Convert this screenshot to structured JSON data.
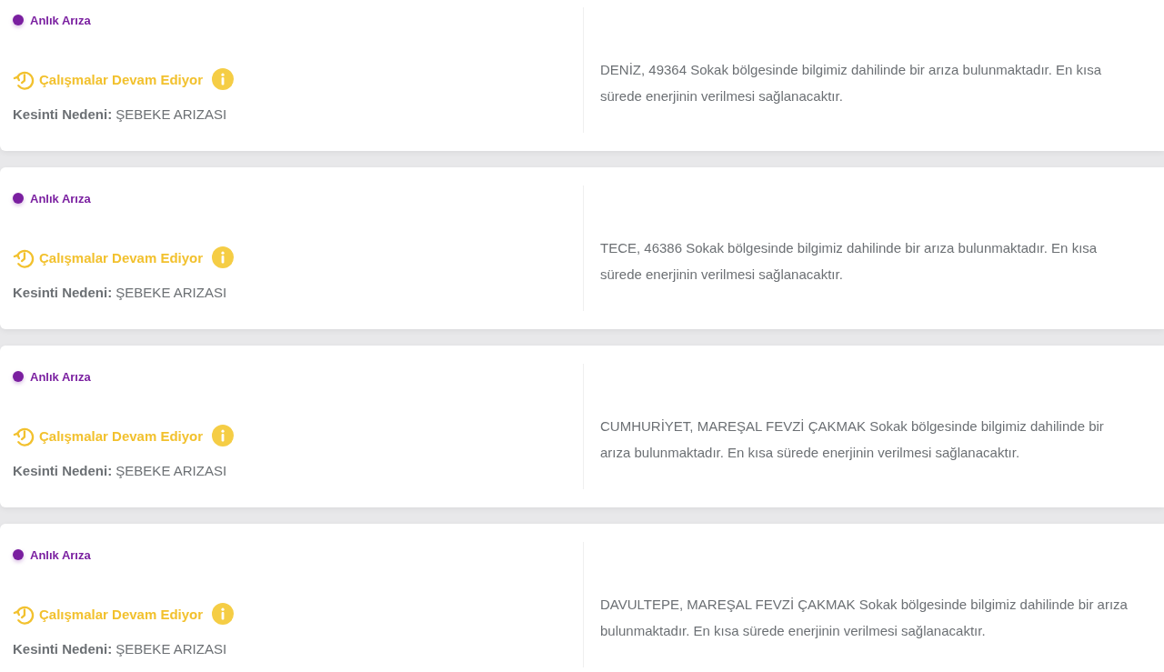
{
  "outages": [
    {
      "type_label": "Anlık Arıza",
      "status": "Çalışmalar Devam Ediyor",
      "reason": "**Kesinti Nedeni:** ŞEBEKE ARIZASI",
      "description": "DENİZ, 49364 Sokak bölgesinde bilgimiz dahilinde bir arıza bulunmaktadır. En kısa sürede enerjinin verilmesi sağlanacaktır."
    },
    {
      "type_label": "Anlık Arıza",
      "status": "Çalışmalar Devam Ediyor",
      "reason": "**Kesinti Nedeni:** ŞEBEKE ARIZASI",
      "description": "TECE, 46386 Sokak bölgesinde bilgimiz dahilinde bir arıza bulunmaktadır. En kısa sürede enerjinin verilmesi sağlanacaktır."
    },
    {
      "type_label": "Anlık Arıza",
      "status": "Çalışmalar Devam Ediyor",
      "reason": "**Kesinti Nedeni:** ŞEBEKE ARIZASI",
      "description": "CUMHURİYET, MAREŞAL FEVZİ ÇAKMAK Sokak bölgesinde bilgimiz dahilinde bir arıza bulunmaktadır. En kısa sürede enerjinin verilmesi sağlanacaktır."
    },
    {
      "type_label": "Anlık Arıza",
      "status": "Çalışmalar Devam Ediyor",
      "reason": "**Kesinti Nedeni:** ŞEBEKE ARIZASI",
      "description": "DAVULTEPE, MAREŞAL FEVZİ ÇAKMAK Sokak bölgesinde bilgimiz dahilinde bir arıza bulunmaktadır. En kısa sürede enerjinin verilmesi sağlanacaktır."
    }
  ]
}
